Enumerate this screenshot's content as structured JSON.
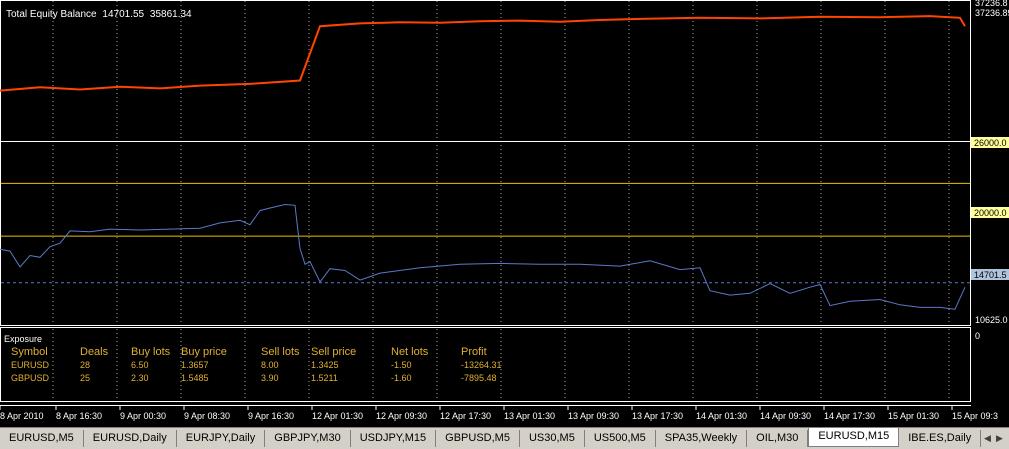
{
  "chart_data": [
    {
      "type": "line",
      "title": "Total Equity Balance",
      "legend_values": [
        "14701.55",
        "35861.34"
      ],
      "y_axis_labels": [
        "37236.8",
        "37236.89"
      ],
      "series": [
        {
          "name": "Balance",
          "color": "#ff4500",
          "values": [
            [
              0,
              35700
            ],
            [
              40,
              35760
            ],
            [
              80,
              35720
            ],
            [
              120,
              35770
            ],
            [
              160,
              35740
            ],
            [
              200,
              35790
            ],
            [
              250,
              35820
            ],
            [
              300,
              35880
            ],
            [
              320,
              36850
            ],
            [
              360,
              36900
            ],
            [
              400,
              36920
            ],
            [
              440,
              36910
            ],
            [
              480,
              36940
            ],
            [
              520,
              36950
            ],
            [
              560,
              36930
            ],
            [
              600,
              36960
            ],
            [
              640,
              36980
            ],
            [
              700,
              37000
            ],
            [
              760,
              36990
            ],
            [
              820,
              37020
            ],
            [
              880,
              37010
            ],
            [
              930,
              37030
            ],
            [
              960,
              37000
            ],
            [
              965,
              36850
            ]
          ]
        }
      ],
      "ylim": [
        34800,
        37300
      ]
    },
    {
      "type": "line",
      "y_axis_labels": [
        "26000.0",
        "20000.0",
        "14701.5",
        "10625.0"
      ],
      "levels": [
        26000,
        20000
      ],
      "current_value": 14701.55,
      "ylim": [
        9900,
        30700
      ],
      "series": [
        {
          "name": "Equity",
          "color": "#5a7ac8",
          "values": [
            [
              0,
              18500
            ],
            [
              10,
              18300
            ],
            [
              20,
              16500
            ],
            [
              30,
              17800
            ],
            [
              40,
              17600
            ],
            [
              50,
              18800
            ],
            [
              60,
              19200
            ],
            [
              70,
              20600
            ],
            [
              90,
              20500
            ],
            [
              110,
              20800
            ],
            [
              140,
              20700
            ],
            [
              170,
              20800
            ],
            [
              200,
              20900
            ],
            [
              220,
              21500
            ],
            [
              240,
              21800
            ],
            [
              250,
              21300
            ],
            [
              260,
              22900
            ],
            [
              270,
              23200
            ],
            [
              285,
              23600
            ],
            [
              295,
              23500
            ],
            [
              300,
              18600
            ],
            [
              305,
              16800
            ],
            [
              310,
              17100
            ],
            [
              320,
              14800
            ],
            [
              330,
              16300
            ],
            [
              345,
              16100
            ],
            [
              360,
              15000
            ],
            [
              380,
              15800
            ],
            [
              420,
              16400
            ],
            [
              460,
              16800
            ],
            [
              500,
              16900
            ],
            [
              540,
              16800
            ],
            [
              580,
              16800
            ],
            [
              620,
              16600
            ],
            [
              650,
              17200
            ],
            [
              680,
              16200
            ],
            [
              700,
              16400
            ],
            [
              710,
              13800
            ],
            [
              730,
              13300
            ],
            [
              750,
              13500
            ],
            [
              770,
              14600
            ],
            [
              790,
              13500
            ],
            [
              810,
              14200
            ],
            [
              820,
              14500
            ],
            [
              830,
              12100
            ],
            [
              850,
              12600
            ],
            [
              880,
              12800
            ],
            [
              900,
              12200
            ],
            [
              920,
              11900
            ],
            [
              940,
              11900
            ],
            [
              955,
              11700
            ],
            [
              965,
              14200
            ]
          ]
        }
      ]
    },
    {
      "type": "table",
      "y_axis_labels": [
        "0"
      ],
      "x_tick_labels": [
        "8 Apr 2010",
        "8 Apr 16:30",
        "9 Apr 00:30",
        "9 Apr 08:30",
        "9 Apr 16:30",
        "12 Apr 01:30",
        "12 Apr 09:30",
        "12 Apr 17:30",
        "13 Apr 01:30",
        "13 Apr 09:30",
        "13 Apr 17:30",
        "14 Apr 01:30",
        "14 Apr 09:30",
        "14 Apr 17:30",
        "15 Apr 01:30",
        "15 Apr 09:3"
      ]
    }
  ],
  "exposure": {
    "title": "Exposure",
    "headers": [
      "Symbol",
      "Deals",
      "Buy lots",
      "Buy price",
      "Sell lots",
      "Sell price",
      "Net lots",
      "Profit"
    ],
    "rows": [
      [
        "EURUSD",
        "28",
        "6.50",
        "1.3657",
        "8.00",
        "1.3425",
        "-1.50",
        "-13264.31"
      ],
      [
        "GBPUSD",
        "25",
        "2.30",
        "1.5485",
        "3.90",
        "1.5211",
        "-1.60",
        "-7895.48"
      ]
    ]
  },
  "tabs": {
    "items": [
      "EURUSD,M5",
      "EURUSD,Daily",
      "EURJPY,Daily",
      "GBPJPY,M30",
      "USDJPY,M15",
      "GBPUSD,M5",
      "US30,M5",
      "US500,M5",
      "SPA35,Weekly",
      "OIL,M30",
      "EURUSD,M15",
      "IBE.ES,Daily"
    ],
    "active_index": 10
  },
  "colors": {
    "background": "#000000",
    "grid": "#aaaaaa",
    "axis": "#ffffff",
    "balance": "#ff4500",
    "equity": "#5a7ac8",
    "level": "#f0c000",
    "table_text": "#e0b030"
  }
}
